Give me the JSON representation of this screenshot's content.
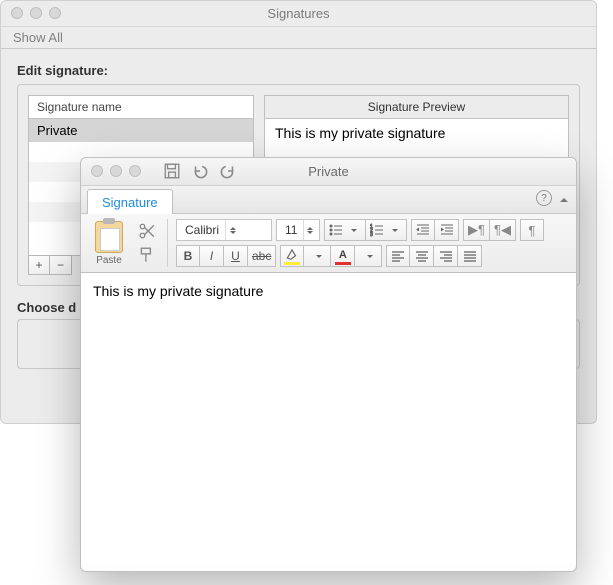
{
  "main": {
    "title": "Signatures",
    "show_all": "Show All",
    "edit_label": "Edit signature:",
    "sig_name_header": "Signature name",
    "sig_rows": [
      "Private"
    ],
    "add_label": "+",
    "remove_label": "−",
    "preview_header": "Signature Preview",
    "preview_text": "This is my private signature",
    "choose_label": "Choose d"
  },
  "editor": {
    "title": "Private",
    "tab_label": "Signature",
    "font_name": "Calibri",
    "font_size": "11",
    "paste_label": "Paste",
    "body_text": "This is my private signature",
    "bold": "B",
    "italic": "I",
    "underline": "U",
    "strike": "abc",
    "highlight_color": "#ffeb3b",
    "font_color": "#e03030"
  }
}
